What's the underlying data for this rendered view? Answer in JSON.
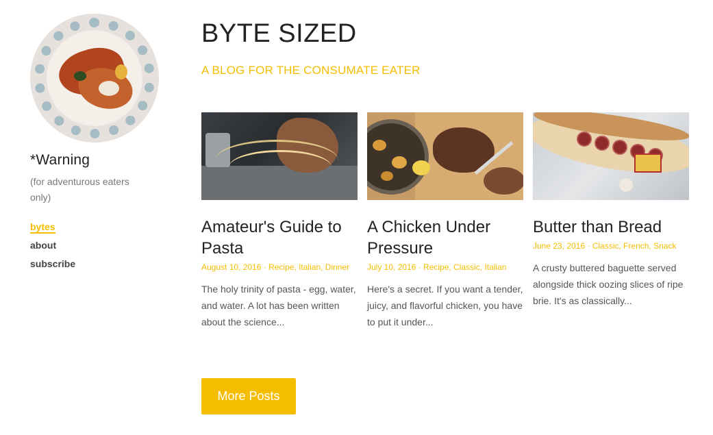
{
  "sidebar": {
    "avatar_alt": "food photo avatar",
    "title": "*Warning",
    "subtitle": "(for adventurous eaters only)",
    "nav": [
      {
        "label": "bytes",
        "active": true
      },
      {
        "label": "about",
        "active": false
      },
      {
        "label": "subscribe",
        "active": false
      }
    ]
  },
  "header": {
    "title": "BYTE SIZED",
    "tagline": "A BLOG FOR THE CONSUMATE EATER"
  },
  "posts": [
    {
      "title": "Amateur's Guide to Pasta",
      "meta": "August 10, 2016 · Recipe, Italian, Dinner",
      "excerpt": "The holy trinity of pasta - egg, water, and water. A lot has been written about the science..."
    },
    {
      "title": "A Chicken Under Pressure",
      "meta": "July 10, 2016 · Recipe, Classic, Italian",
      "excerpt": "Here's a secret. If you want a tender, juicy, and flavorful chicken, you have to put it under..."
    },
    {
      "title": "Butter than Bread",
      "meta": "June 23, 2016 · Classic, French, Snack",
      "excerpt": "A crusty buttered baguette served alongside thick oozing slices of ripe brie. It's as classically..."
    }
  ],
  "more_button": {
    "label": "More Posts"
  },
  "colors": {
    "accent": "#f5bd00",
    "text": "#222222",
    "muted": "#777777"
  }
}
